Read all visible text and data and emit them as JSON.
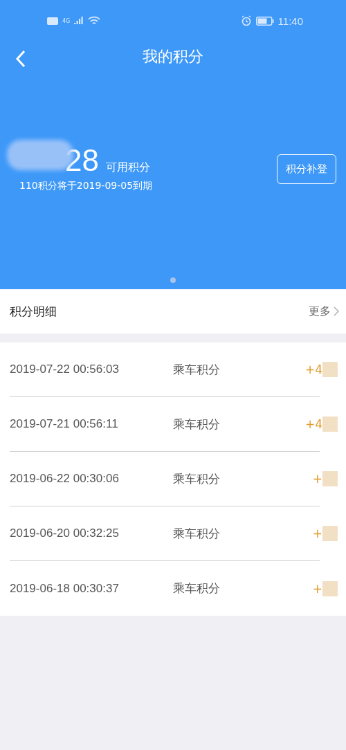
{
  "status_bar": {
    "network": "4G",
    "time": "11:40"
  },
  "nav": {
    "title": "我的积分"
  },
  "summary": {
    "points": "28",
    "points_label": "可用积分",
    "expiry_note": "110积分将于2019-09-05到期",
    "button": "积分补登",
    "pager": [
      {
        "selected": true
      }
    ]
  },
  "details_header": {
    "title": "积分明细",
    "more": "更多"
  },
  "records": [
    {
      "time": "2019-07-22 00:56:03",
      "type": "乘车积分",
      "amount": "+4"
    },
    {
      "time": "2019-07-21 00:56:11",
      "type": "乘车积分",
      "amount": "+4"
    },
    {
      "time": "2019-06-22 00:30:06",
      "type": "乘车积分",
      "amount": "+"
    },
    {
      "time": "2019-06-20 00:32:25",
      "type": "乘车积分",
      "amount": "+"
    },
    {
      "time": "2019-06-18 00:30:37",
      "type": "乘车积分",
      "amount": "+"
    }
  ]
}
